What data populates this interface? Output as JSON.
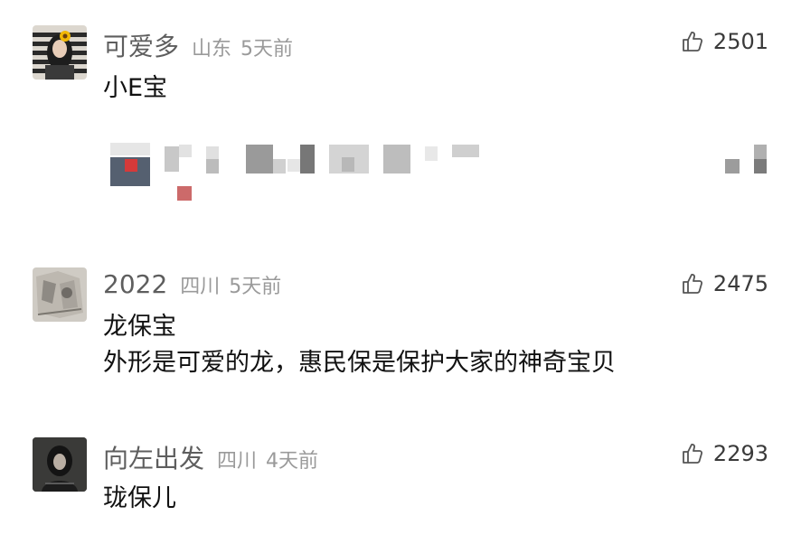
{
  "comments": [
    {
      "name": "可爱多",
      "location": "山东",
      "time": "5天前",
      "likes": "2501",
      "lines": [
        "小E宝"
      ]
    },
    {
      "name": "2022",
      "location": "四川",
      "time": "5天前",
      "likes": "2475",
      "lines": [
        "龙保宝",
        "外形是可爱的龙，惠民保是保护大家的神奇宝贝"
      ]
    },
    {
      "name": "向左出发",
      "location": "四川",
      "time": "4天前",
      "likes": "2293",
      "lines": [
        "珑保儿"
      ]
    }
  ],
  "icons": {
    "like": "thumbs-up-icon"
  },
  "colors": {
    "name": "#5e5e5e",
    "meta": "#9a9a9a",
    "text": "#111111"
  }
}
